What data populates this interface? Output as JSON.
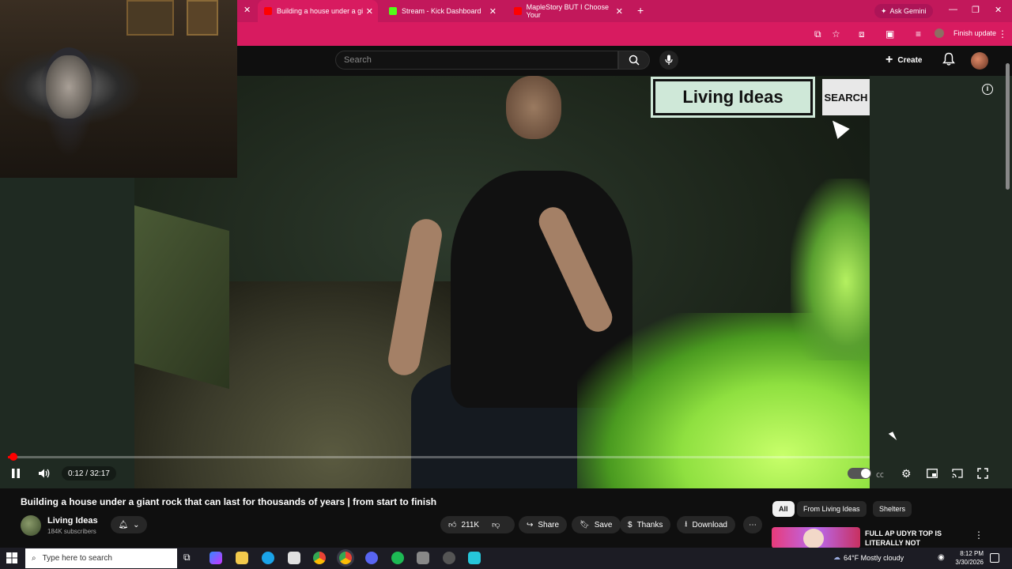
{
  "browser": {
    "tabs": [
      {
        "title": "Building a house under a gi",
        "active": true
      },
      {
        "title": "Stream - Kick Dashboard",
        "active": false
      },
      {
        "title": "MapleStory BUT I Choose Your",
        "active": false
      }
    ],
    "ask_gemini": "Ask Gemini",
    "finish_update": "Finish update",
    "accent": "#c2185b"
  },
  "youtube": {
    "search_placeholder": "Search",
    "create_label": "Create"
  },
  "overlay": {
    "brand": "Living Ideas",
    "search_label": "SEARCH"
  },
  "player": {
    "time": "0:12 / 32:17",
    "progress": 0.006
  },
  "video": {
    "title": "Building a house under a giant rock that can last for thousands of years | from start to finish",
    "channel": "Living Ideas",
    "subscribers": "184K subscribers",
    "likes": "211K",
    "share": "Share",
    "save": "Save",
    "thanks": "Thanks",
    "download": "Download"
  },
  "chips": [
    "All",
    "From Living Ideas",
    "Shelters"
  ],
  "recommended": {
    "title": "FULL AP UDYR TOP IS LITERALLY NOT BALANCED..."
  },
  "taskbar": {
    "search_placeholder": "Type here to search",
    "weather": "64°F  Mostly cloudy",
    "time": "8:12 PM",
    "date": "3/30/2026"
  }
}
